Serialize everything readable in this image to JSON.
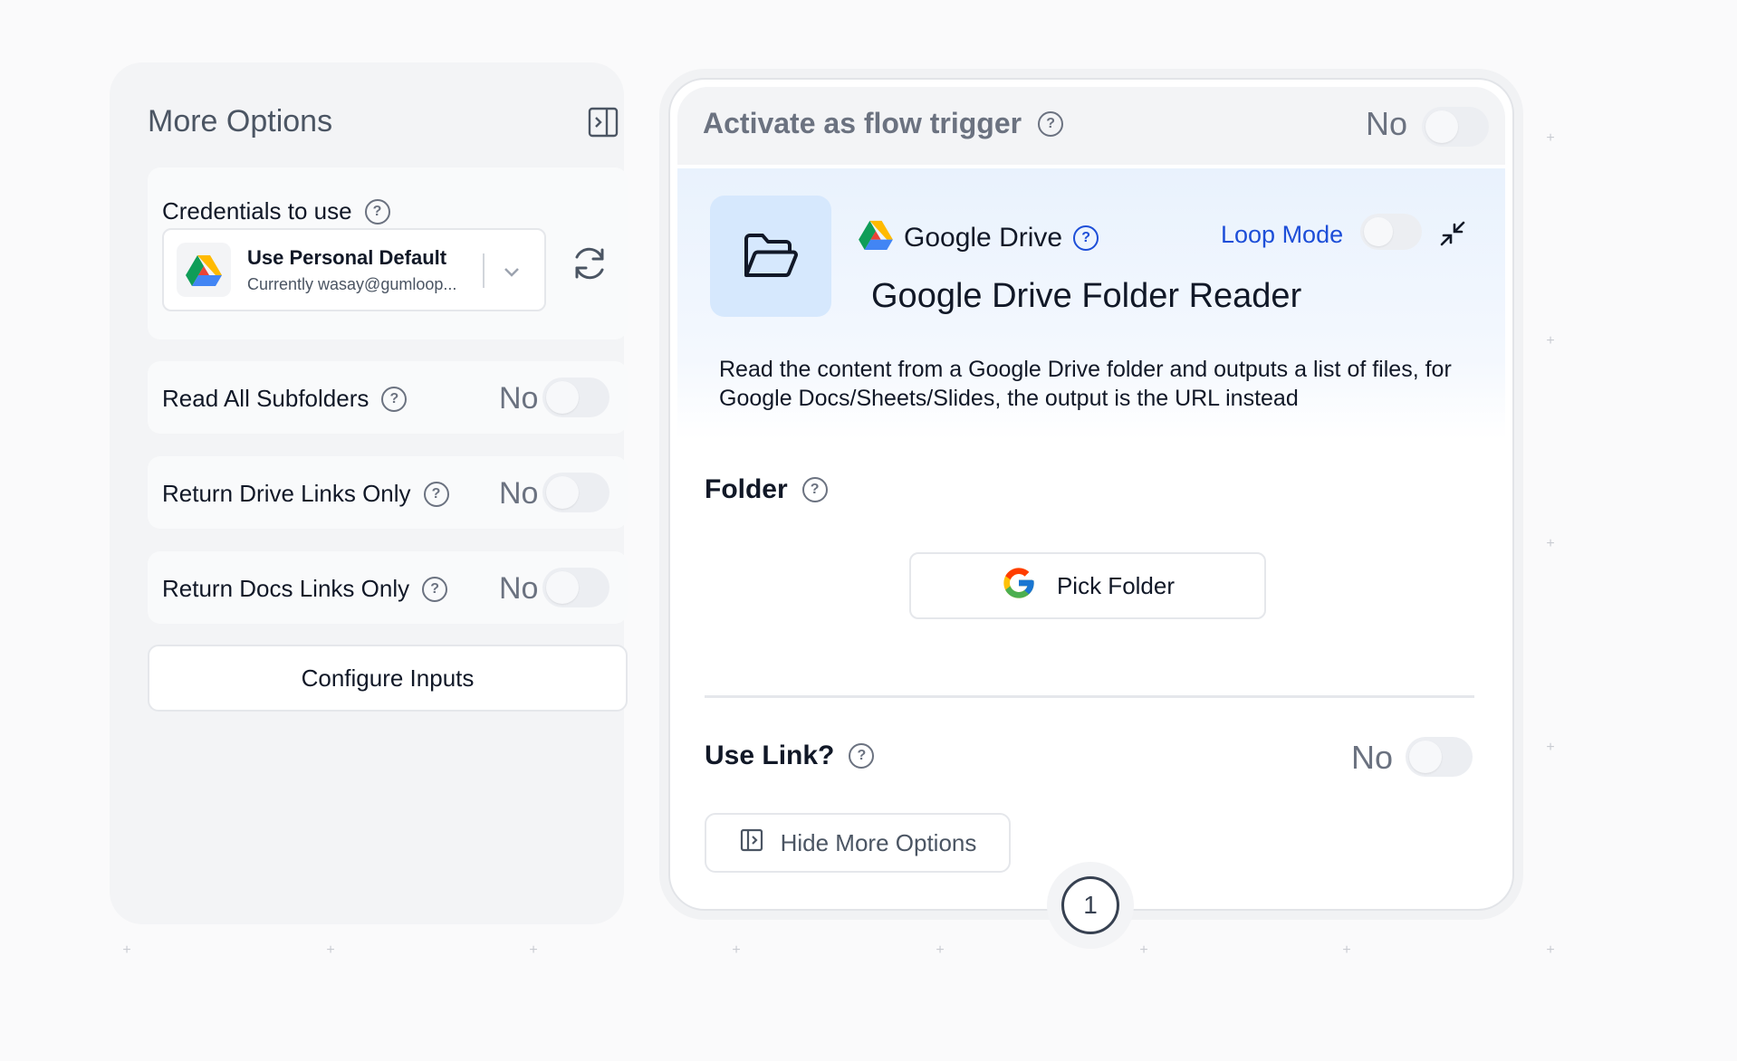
{
  "sidebar": {
    "title": "More Options",
    "credentials": {
      "label": "Credentials to use",
      "selected": "Use Personal Default",
      "account": "Currently wasay@gumloop..."
    },
    "toggles": [
      {
        "label": "Read All Subfolders",
        "value": "No",
        "on": false
      },
      {
        "label": "Return Drive Links Only",
        "value": "No",
        "on": false
      },
      {
        "label": "Return Docs Links Only",
        "value": "No",
        "on": false
      }
    ],
    "configure_label": "Configure Inputs"
  },
  "node": {
    "trigger": {
      "label": "Activate as flow trigger",
      "value": "No",
      "on": false
    },
    "service": "Google Drive",
    "loop_mode_label": "Loop Mode",
    "loop_mode_on": false,
    "title": "Google Drive Folder Reader",
    "description": "Read the content from a Google Drive folder and outputs a list of files, for Google Docs/Sheets/Slides, the output is the URL instead",
    "folder_label": "Folder",
    "pick_folder_label": "Pick Folder",
    "use_link": {
      "label": "Use Link?",
      "value": "No",
      "on": false
    },
    "hide_more_options_label": "Hide More Options",
    "badge": "1"
  },
  "colors": {
    "accent": "#1d4ed8",
    "node_icon_bg": "#d6e8fd",
    "panel_bg": "#f3f4f6"
  },
  "icons": [
    "sidebar-collapse-icon",
    "help-icon",
    "google-drive-icon",
    "chevron-down-icon",
    "refresh-icon",
    "folder-open-icon",
    "collapse-arrows-icon",
    "google-g-icon",
    "panel-icon"
  ]
}
